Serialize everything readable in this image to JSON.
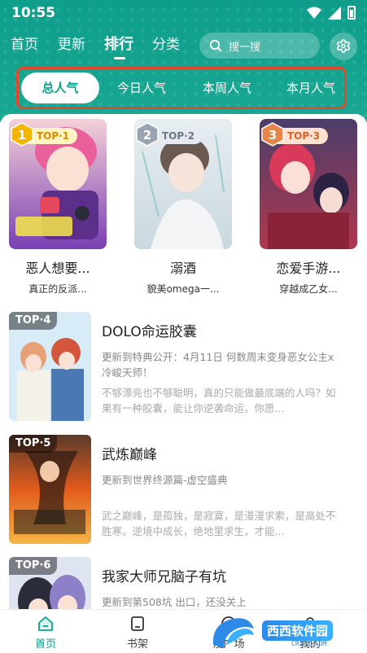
{
  "status_bar": {
    "time": "10:55"
  },
  "top_nav": {
    "tabs": [
      {
        "label": "首页"
      },
      {
        "label": "更新"
      },
      {
        "label": "排行"
      },
      {
        "label": "分类"
      }
    ],
    "active": "排行"
  },
  "search": {
    "placeholder": "搜一搜"
  },
  "subtabs": [
    {
      "label": "总人气"
    },
    {
      "label": "今日人气"
    },
    {
      "label": "本周人气"
    },
    {
      "label": "本月人气"
    }
  ],
  "top3": [
    {
      "rank": "1",
      "tag": "TOP·1",
      "title": "恶人想要...",
      "subtitle": "真正的反派..."
    },
    {
      "rank": "2",
      "tag": "TOP·2",
      "title": "溺酒",
      "subtitle": "貌美omega一..."
    },
    {
      "rank": "3",
      "tag": "TOP·3",
      "title": "恋爱手游...",
      "subtitle": "穿越成乙女..."
    }
  ],
  "ranking": [
    {
      "tag": "TOP·4",
      "title": "DOLO命运胶囊",
      "update": "更新到特典公开：4月11日 何数周末变身恶女公主x冷峻天师！",
      "desc": "不够漂亮也不够聪明，真的只能做最底端的人吗？如果有一种胶囊，能让你逆袭命运，你愿..."
    },
    {
      "tag": "TOP·5",
      "title": "武炼巅峰",
      "update": "更新到世界终源篇-虚空盛典",
      "desc": "武之巅峰，是孤独，是寂寞，是漫漫求索，是高处不胜寒。逆境中成长，绝地里求生，才能..."
    },
    {
      "tag": "TOP·6",
      "title": "我家大师兄脑子有坑",
      "update": "更新到第508坑 出口，还没关上",
      "desc": ""
    }
  ],
  "bottom_nav": [
    {
      "label": "首页"
    },
    {
      "label": "书架"
    },
    {
      "label": "漫广场"
    },
    {
      "label": "我的"
    }
  ],
  "watermark": {
    "label": "西西软件园",
    "sub": "CR173.COM"
  },
  "colors": {
    "accent": "#10a08c",
    "highlight_frame": "#e04a2c",
    "gold": "#f5b400",
    "silver": "#9aa3b0",
    "bronze": "#e8864a"
  }
}
